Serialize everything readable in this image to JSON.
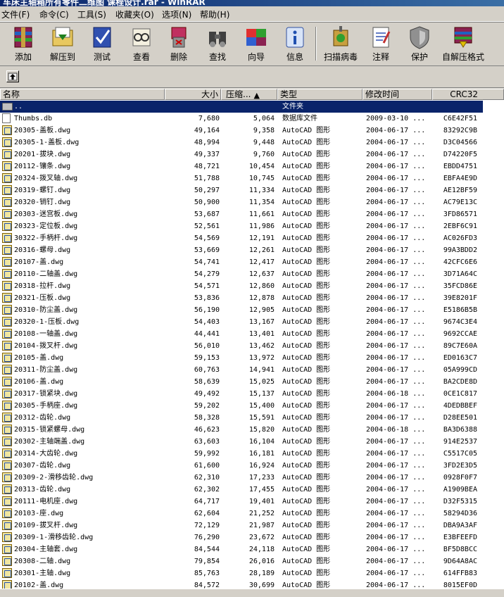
{
  "window": {
    "title": "车床主轴箱所有零件二维图 课程设计.rar - WinRAR"
  },
  "menu": [
    {
      "label": "文件(F)"
    },
    {
      "label": "命令(C)"
    },
    {
      "label": "工具(S)"
    },
    {
      "label": "收藏夹(O)"
    },
    {
      "label": "选项(N)"
    },
    {
      "label": "帮助(H)"
    }
  ],
  "toolbar": [
    {
      "label": "添加",
      "icon": "add-archive-icon"
    },
    {
      "label": "解压到",
      "icon": "extract-to-icon"
    },
    {
      "label": "测试",
      "icon": "test-icon"
    },
    {
      "label": "查看",
      "icon": "view-icon"
    },
    {
      "label": "删除",
      "icon": "delete-icon"
    },
    {
      "label": "查找",
      "icon": "find-icon"
    },
    {
      "label": "向导",
      "icon": "wizard-icon"
    },
    {
      "label": "信息",
      "icon": "info-icon"
    },
    {
      "label": "扫描病毒",
      "icon": "virus-scan-icon"
    },
    {
      "label": "注释",
      "icon": "comment-icon"
    },
    {
      "label": "保护",
      "icon": "protect-icon"
    },
    {
      "label": "自解压格式",
      "icon": "sfx-icon"
    }
  ],
  "columns": {
    "name": "名称",
    "size": "大小",
    "packed": "压缩...",
    "type": "类型",
    "modified": "修改时间",
    "crc": "CRC32"
  },
  "folder_row": {
    "name": "..",
    "type": "文件夹"
  },
  "files": [
    {
      "name": "Thumbs.db",
      "size": "7,680",
      "packed": "5,064",
      "type": "数据库文件",
      "modified": "2009-03-10 ...",
      "crc": "C6E42F51",
      "icon": "db"
    },
    {
      "name": "20305-盖板.dwg",
      "size": "49,164",
      "packed": "9,358",
      "type": "AutoCAD 图形",
      "modified": "2004-06-17 ...",
      "crc": "83292C9B",
      "icon": "cad"
    },
    {
      "name": "20305-1-盖板.dwg",
      "size": "48,994",
      "packed": "9,448",
      "type": "AutoCAD 图形",
      "modified": "2004-06-17 ...",
      "crc": "D3C04566",
      "icon": "cad"
    },
    {
      "name": "20201-拔块.dwg",
      "size": "49,337",
      "packed": "9,760",
      "type": "AutoCAD 图形",
      "modified": "2004-06-17 ...",
      "crc": "D74220F5",
      "icon": "cad"
    },
    {
      "name": "20112-镶条.dwg",
      "size": "48,721",
      "packed": "10,454",
      "type": "AutoCAD 图形",
      "modified": "2004-06-17 ...",
      "crc": "EBDD4751",
      "icon": "cad"
    },
    {
      "name": "20324-拨叉轴.dwg",
      "size": "51,788",
      "packed": "10,745",
      "type": "AutoCAD 图形",
      "modified": "2004-06-17 ...",
      "crc": "EBFA4E9D",
      "icon": "cad"
    },
    {
      "name": "20319-螺钉.dwg",
      "size": "50,297",
      "packed": "11,334",
      "type": "AutoCAD 图形",
      "modified": "2004-06-17 ...",
      "crc": "AE12BF59",
      "icon": "cad"
    },
    {
      "name": "20320-销钉.dwg",
      "size": "50,900",
      "packed": "11,354",
      "type": "AutoCAD 图形",
      "modified": "2004-06-17 ...",
      "crc": "AC79E13C",
      "icon": "cad"
    },
    {
      "name": "20303-迷宫板.dwg",
      "size": "53,687",
      "packed": "11,661",
      "type": "AutoCAD 图形",
      "modified": "2004-06-17 ...",
      "crc": "3FD86571",
      "icon": "cad"
    },
    {
      "name": "20323-定位板.dwg",
      "size": "52,561",
      "packed": "11,986",
      "type": "AutoCAD 图形",
      "modified": "2004-06-17 ...",
      "crc": "2EBF6C91",
      "icon": "cad"
    },
    {
      "name": "30322-手柄杆.dwg",
      "size": "54,569",
      "packed": "12,191",
      "type": "AutoCAD 图形",
      "modified": "2004-06-17 ...",
      "crc": "AC026FD3",
      "icon": "cad"
    },
    {
      "name": "20316-螺母.dwg",
      "size": "53,669",
      "packed": "12,261",
      "type": "AutoCAD 图形",
      "modified": "2004-06-17 ...",
      "crc": "99A3BDD2",
      "icon": "cad"
    },
    {
      "name": "20107-盖.dwg",
      "size": "54,741",
      "packed": "12,417",
      "type": "AutoCAD 图形",
      "modified": "2004-06-17 ...",
      "crc": "42CFC6E6",
      "icon": "cad"
    },
    {
      "name": "20110-二轴盖.dwg",
      "size": "54,279",
      "packed": "12,637",
      "type": "AutoCAD 图形",
      "modified": "2004-06-17 ...",
      "crc": "3D71A64C",
      "icon": "cad"
    },
    {
      "name": "20318-拉杆.dwg",
      "size": "54,571",
      "packed": "12,860",
      "type": "AutoCAD 图形",
      "modified": "2004-06-17 ...",
      "crc": "35FCD86E",
      "icon": "cad"
    },
    {
      "name": "20321-压板.dwg",
      "size": "53,836",
      "packed": "12,878",
      "type": "AutoCAD 图形",
      "modified": "2004-06-17 ...",
      "crc": "39E8201F",
      "icon": "cad"
    },
    {
      "name": "20310-防尘盖.dwg",
      "size": "56,190",
      "packed": "12,905",
      "type": "AutoCAD 图形",
      "modified": "2004-06-17 ...",
      "crc": "E5186B5B",
      "icon": "cad"
    },
    {
      "name": "20320-1-压板.dwg",
      "size": "54,403",
      "packed": "13,167",
      "type": "AutoCAD 图形",
      "modified": "2004-06-17 ...",
      "crc": "9674C3E4",
      "icon": "cad"
    },
    {
      "name": "20108-一轴盖.dwg",
      "size": "44,441",
      "packed": "13,401",
      "type": "AutoCAD 图形",
      "modified": "2004-06-17 ...",
      "crc": "9692CCAE",
      "icon": "cad"
    },
    {
      "name": "20104-拨叉杆.dwg",
      "size": "56,010",
      "packed": "13,462",
      "type": "AutoCAD 图形",
      "modified": "2004-06-17 ...",
      "crc": "89C7E60A",
      "icon": "cad"
    },
    {
      "name": "20105-盖.dwg",
      "size": "59,153",
      "packed": "13,972",
      "type": "AutoCAD 图形",
      "modified": "2004-06-17 ...",
      "crc": "ED0163C7",
      "icon": "cad"
    },
    {
      "name": "20311-防尘盖.dwg",
      "size": "60,763",
      "packed": "14,941",
      "type": "AutoCAD 图形",
      "modified": "2004-06-17 ...",
      "crc": "05A999CD",
      "icon": "cad"
    },
    {
      "name": "20106-盖.dwg",
      "size": "58,639",
      "packed": "15,025",
      "type": "AutoCAD 图形",
      "modified": "2004-06-17 ...",
      "crc": "BA2CDE8D",
      "icon": "cad"
    },
    {
      "name": "20317-锁紧块.dwg",
      "size": "49,492",
      "packed": "15,137",
      "type": "AutoCAD 图形",
      "modified": "2004-06-18 ...",
      "crc": "0CE1C817",
      "icon": "cad"
    },
    {
      "name": "20305-手柄座.dwg",
      "size": "59,202",
      "packed": "15,400",
      "type": "AutoCAD 图形",
      "modified": "2004-06-17 ...",
      "crc": "4DEDBBEF",
      "icon": "cad"
    },
    {
      "name": "20312-齿轮.dwg",
      "size": "58,328",
      "packed": "15,591",
      "type": "AutoCAD 图形",
      "modified": "2004-06-17 ...",
      "crc": "D28EE501",
      "icon": "cad"
    },
    {
      "name": "20315-锁紧螺母.dwg",
      "size": "46,623",
      "packed": "15,820",
      "type": "AutoCAD 图形",
      "modified": "2004-06-18 ...",
      "crc": "BA3D6388",
      "icon": "cad"
    },
    {
      "name": "20302-主轴端盖.dwg",
      "size": "63,603",
      "packed": "16,104",
      "type": "AutoCAD 图形",
      "modified": "2004-06-17 ...",
      "crc": "914E2537",
      "icon": "cad"
    },
    {
      "name": "20314-大齿轮.dwg",
      "size": "59,992",
      "packed": "16,181",
      "type": "AutoCAD 图形",
      "modified": "2004-06-17 ...",
      "crc": "C5517C05",
      "icon": "cad"
    },
    {
      "name": "20307-齿轮.dwg",
      "size": "61,600",
      "packed": "16,924",
      "type": "AutoCAD 图形",
      "modified": "2004-06-17 ...",
      "crc": "3FD2E3D5",
      "icon": "cad"
    },
    {
      "name": "20309-2-滑移齿轮.dwg",
      "size": "62,310",
      "packed": "17,233",
      "type": "AutoCAD 图形",
      "modified": "2004-06-17 ...",
      "crc": "0928F0F7",
      "icon": "cad"
    },
    {
      "name": "20313-齿轮.dwg",
      "size": "62,302",
      "packed": "17,455",
      "type": "AutoCAD 图形",
      "modified": "2004-06-17 ...",
      "crc": "A1909BEA",
      "icon": "cad"
    },
    {
      "name": "20111-电机座.dwg",
      "size": "64,717",
      "packed": "19,401",
      "type": "AutoCAD 图形",
      "modified": "2004-06-17 ...",
      "crc": "D32F5315",
      "icon": "cad"
    },
    {
      "name": "20103-座.dwg",
      "size": "62,604",
      "packed": "21,252",
      "type": "AutoCAD 图形",
      "modified": "2004-06-17 ...",
      "crc": "58294D36",
      "icon": "cad"
    },
    {
      "name": "20109-拔叉杆.dwg",
      "size": "72,129",
      "packed": "21,987",
      "type": "AutoCAD 图形",
      "modified": "2004-06-17 ...",
      "crc": "DBA9A3AF",
      "icon": "cad"
    },
    {
      "name": "20309-1-滑移齿轮.dwg",
      "size": "76,290",
      "packed": "23,672",
      "type": "AutoCAD 图形",
      "modified": "2004-06-17 ...",
      "crc": "E3BFEEFD",
      "icon": "cad"
    },
    {
      "name": "20304-主轴套.dwg",
      "size": "84,544",
      "packed": "24,118",
      "type": "AutoCAD 图形",
      "modified": "2004-06-17 ...",
      "crc": "BF5D8BCC",
      "icon": "cad"
    },
    {
      "name": "20308-二轴.dwg",
      "size": "79,854",
      "packed": "26,016",
      "type": "AutoCAD 图形",
      "modified": "2004-06-17 ...",
      "crc": "9D64A8AC",
      "icon": "cad"
    },
    {
      "name": "20301-主轴.dwg",
      "size": "85,763",
      "packed": "28,189",
      "type": "AutoCAD 图形",
      "modified": "2004-06-17 ...",
      "crc": "614FFB83",
      "icon": "cad"
    },
    {
      "name": "20102-盖.dwg",
      "size": "84,572",
      "packed": "30,699",
      "type": "AutoCAD 图形",
      "modified": "2004-06-17 ...",
      "crc": "8015EF0D",
      "icon": "cad"
    }
  ]
}
